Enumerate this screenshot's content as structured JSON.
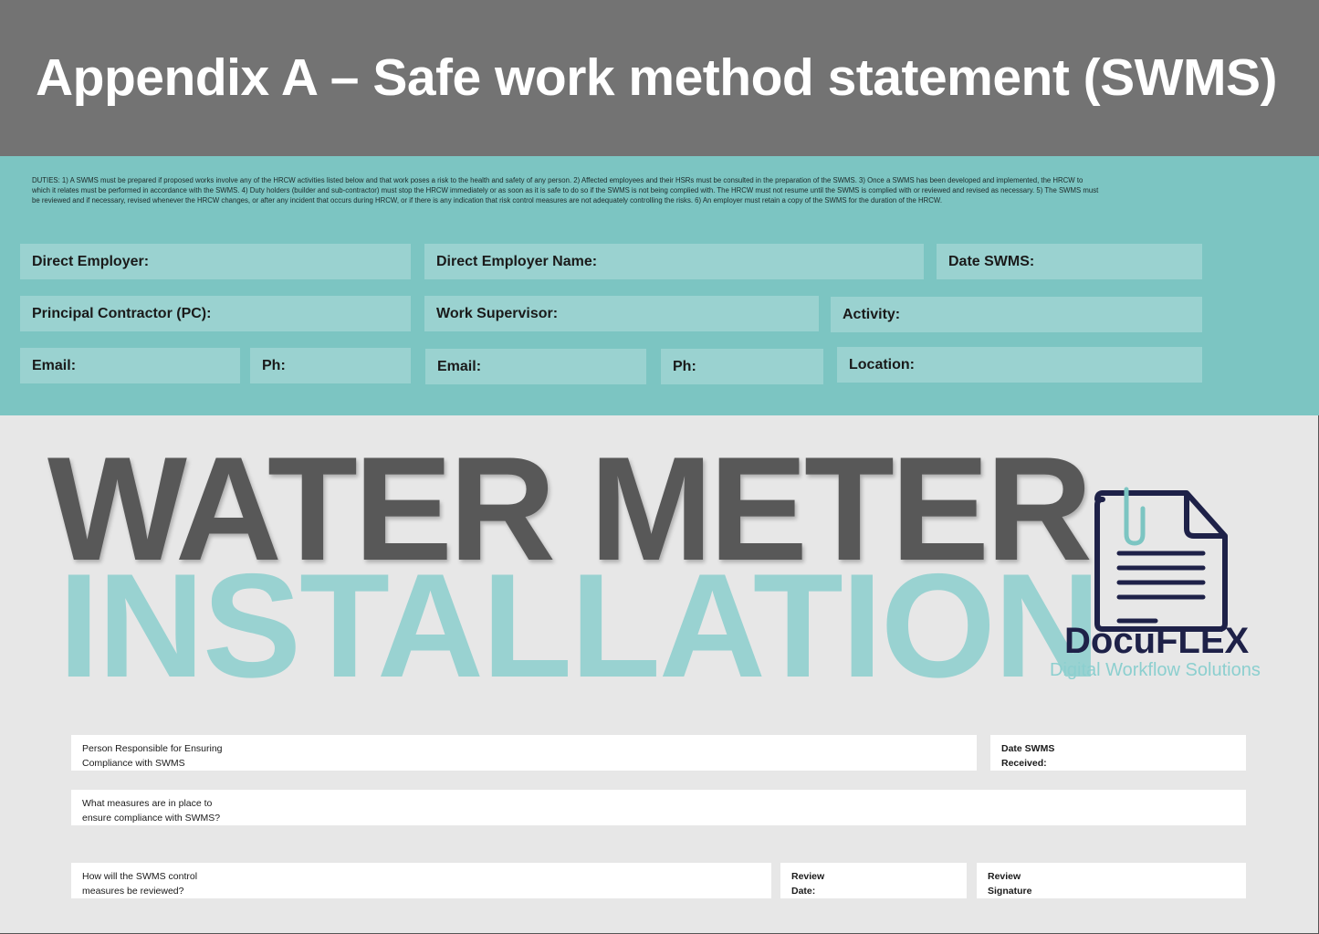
{
  "header": {
    "title": "Appendix A – Safe work method statement (SWMS)"
  },
  "duties_text": "DUTIES: 1) A SWMS must be prepared if proposed works involve any of the HRCW activities listed below and that work poses a risk to the health and safety of any person. 2) Affected employees and their HSRs must be consulted in the preparation of the SWMS. 3) Once a SWMS has been developed and implemented, the HRCW to which it relates must be performed in accordance with the SWMS. 4) Duty holders (builder and sub-contractor) must stop the HRCW immediately or as soon as it is safe to do so if the SWMS is not being complied with. The HRCW must not resume until the SWMS is complied with or reviewed and revised as necessary. 5) The SWMS must be reviewed and if necessary, revised whenever the HRCW changes, or after any incident that occurs during HRCW, or if there is any indication that risk control measures are not adequately controlling the risks. 6) An employer must retain a copy of the SWMS for the duration of the HRCW.",
  "fields": {
    "direct_employer": "Direct Employer:",
    "direct_employer_name": "Direct Employer Name:",
    "date_swms": "Date SWMS:",
    "principal_contractor": "Principal Contractor (PC):",
    "work_supervisor": "Work Supervisor:",
    "activity": "Activity:",
    "pc_email": "Email:",
    "pc_phone": "Ph:",
    "ws_email": "Email:",
    "ws_phone": "Ph:",
    "location": "Location:"
  },
  "banner": {
    "line1": "WATER METER",
    "line2": "INSTALLATION"
  },
  "logo": {
    "name": "DocuFLEX",
    "tagline": "Digital Workflow Solutions"
  },
  "compliance": {
    "person_responsible": "Person Responsible for Ensuring\nCompliance with SWMS",
    "date_received": "Date SWMS\nReceived:",
    "measures": "What measures are in place to\nensure compliance with SWMS?",
    "review_how": "How will the SWMS control\nmeasures be reviewed?",
    "review_date": "Review\nDate:",
    "review_signature": "Review\nSignature"
  },
  "colors": {
    "header_bg": "#737373",
    "teal_bg": "#7cc5c2",
    "field_bg": "#9ad2d0",
    "accent_teal": "#99d2d1",
    "dark_gray": "#585858",
    "logo_navy": "#1e2148"
  }
}
